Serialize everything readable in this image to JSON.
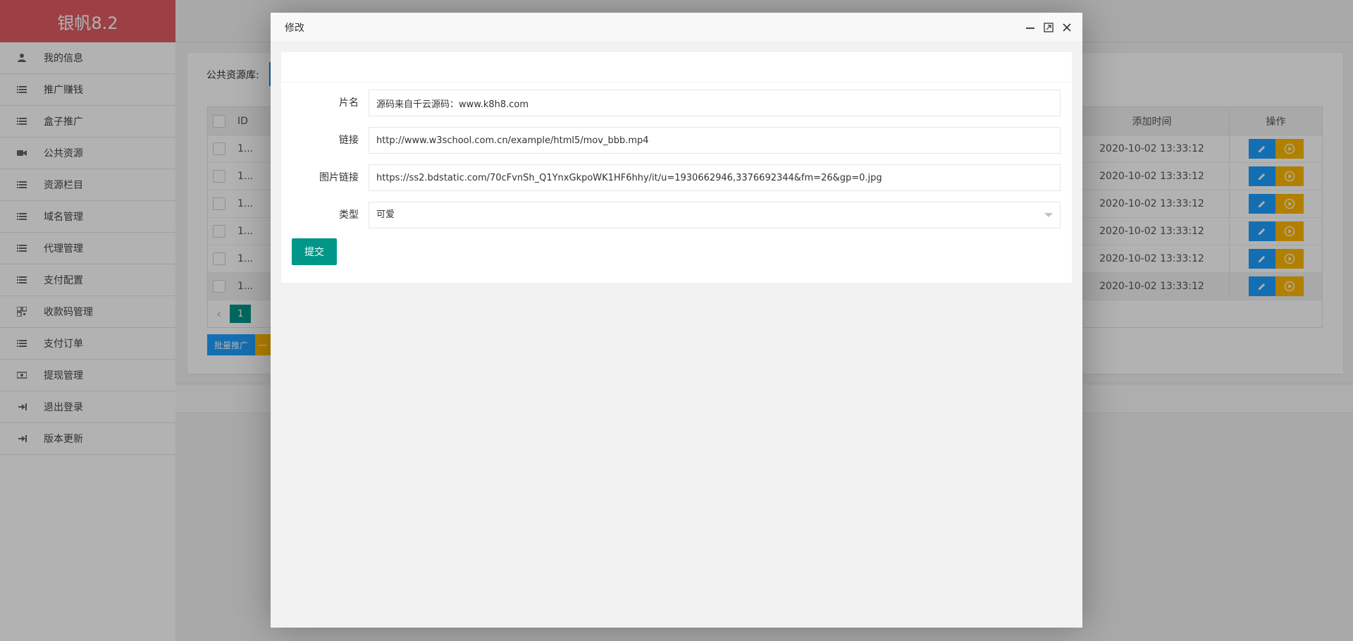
{
  "brand": "银帆8.2",
  "sidebar": {
    "items": [
      {
        "label": "我的信息",
        "icon": "user-icon"
      },
      {
        "label": "推广赚钱",
        "icon": "list-icon"
      },
      {
        "label": "盒子推广",
        "icon": "list-icon"
      },
      {
        "label": "公共资源",
        "icon": "video-camera-icon"
      },
      {
        "label": "资源栏目",
        "icon": "list-icon"
      },
      {
        "label": "域名管理",
        "icon": "list-icon"
      },
      {
        "label": "代理管理",
        "icon": "list-icon"
      },
      {
        "label": "支付配置",
        "icon": "list-icon"
      },
      {
        "label": "收款码管理",
        "icon": "qrcode-icon"
      },
      {
        "label": "支付订单",
        "icon": "list-icon"
      },
      {
        "label": "提现管理",
        "icon": "money-icon"
      },
      {
        "label": "退出登录",
        "icon": "sign-in-icon"
      },
      {
        "label": "版本更新",
        "icon": "sign-in-icon"
      }
    ]
  },
  "main": {
    "library_label": "公共资源库:",
    "table": {
      "columns": {
        "id": "ID",
        "time": "添加时间",
        "op": "操作"
      },
      "rows": [
        {
          "id": "1...",
          "time": "2020-10-02 13:33:12"
        },
        {
          "id": "1...",
          "time": "2020-10-02 13:33:12"
        },
        {
          "id": "1...",
          "time": "2020-10-02 13:33:12"
        },
        {
          "id": "1...",
          "time": "2020-10-02 13:33:12"
        },
        {
          "id": "1...",
          "time": "2020-10-02 13:33:12"
        },
        {
          "id": "1...",
          "time": "2020-10-02 13:33:12"
        }
      ]
    },
    "pager": {
      "current": "1"
    },
    "batch_button": "批量推广",
    "batch_button2": "一"
  },
  "modal": {
    "title": "修改",
    "fields": {
      "name": {
        "label": "片名",
        "value": "源码来自千云源码：www.k8h8.com"
      },
      "link": {
        "label": "链接",
        "value": "http://www.w3school.com.cn/example/html5/mov_bbb.mp4"
      },
      "image": {
        "label": "图片链接",
        "value": "https://ss2.bdstatic.com/70cFvnSh_Q1YnxGkpoWK1HF6hhy/it/u=1930662946,3376692344&fm=26&gp=0.jpg"
      },
      "type": {
        "label": "类型",
        "value": "可爱"
      }
    },
    "submit_label": "提交"
  },
  "colors": {
    "brand": "#e05c63",
    "primary": "#009688",
    "blue": "#1e9fff",
    "warm": "#ffb800"
  }
}
